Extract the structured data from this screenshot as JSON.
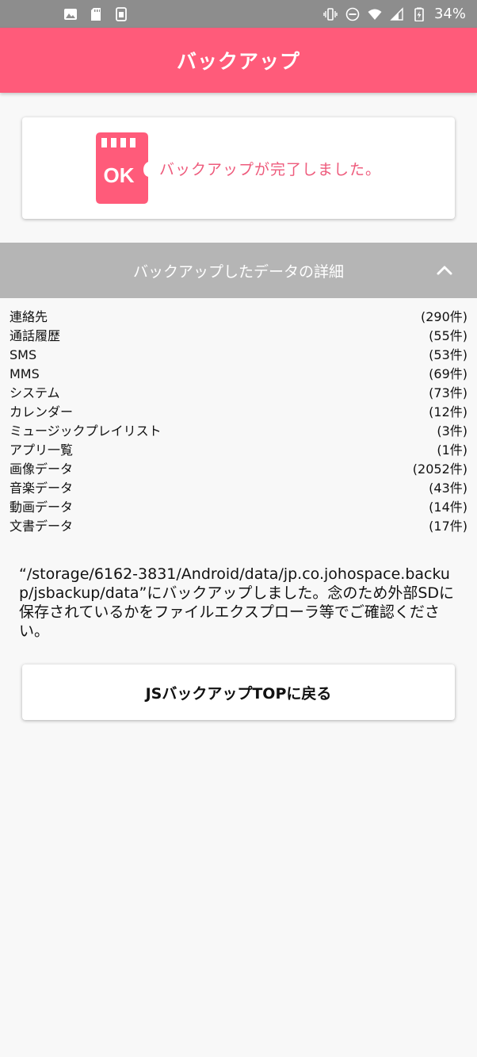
{
  "status_bar": {
    "battery": "34%",
    "icons": [
      "image-icon",
      "sd-card-icon",
      "phone-sd-icon",
      "vibrate-icon",
      "do-not-disturb-icon",
      "wifi-icon",
      "signal-icon",
      "battery-icon"
    ]
  },
  "app_bar": {
    "title": "バックアップ"
  },
  "result_card": {
    "badge": "OK",
    "message": "バックアップが完了しました。",
    "icon": "sd-card-ok-icon",
    "accent": "#ff5b7a"
  },
  "details": {
    "header": "バックアップしたデータの詳細",
    "items": [
      {
        "label": "連絡先",
        "count": "(290件)"
      },
      {
        "label": "通話履歴",
        "count": "(55件)"
      },
      {
        "label": "SMS",
        "count": "(53件)"
      },
      {
        "label": "MMS",
        "count": "(69件)"
      },
      {
        "label": "システム",
        "count": "(73件)"
      },
      {
        "label": "カレンダー",
        "count": "(12件)"
      },
      {
        "label": "ミュージックプレイリスト",
        "count": "(3件)"
      },
      {
        "label": "アプリ一覧",
        "count": "(1件)"
      },
      {
        "label": "画像データ",
        "count": "(2052件)"
      },
      {
        "label": "音楽データ",
        "count": "(43件)"
      },
      {
        "label": "動画データ",
        "count": "(14件)"
      },
      {
        "label": "文書データ",
        "count": "(17件)"
      }
    ]
  },
  "note": "“/storage/6162-3831/Android/data/jp.co.johospace.backup/jsbackup/data”にバックアップしました。念のため外部SDに保存されているかをファイルエクスプローラ等でご確認ください。",
  "top_button": {
    "label": "JSバックアップTOPに戻る"
  }
}
